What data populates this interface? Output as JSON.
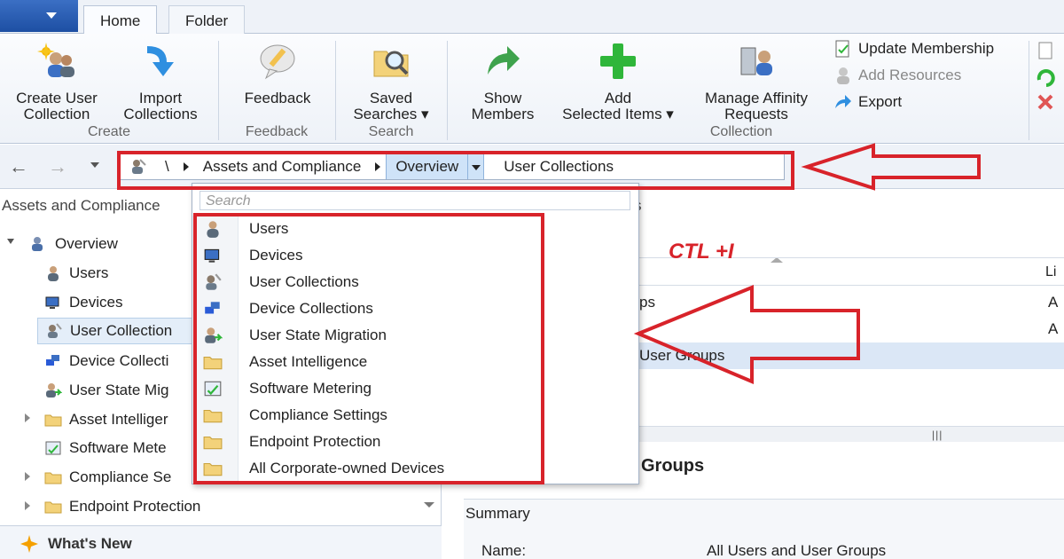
{
  "ribbon": {
    "tabs": [
      {
        "label": "Home"
      },
      {
        "label": "Folder"
      }
    ],
    "buttons": {
      "create_user_collection": "Create User\nCollection",
      "import_collections": "Import\nCollections",
      "feedback": "Feedback",
      "saved_searches": "Saved\nSearches ▾",
      "show_members": "Show\nMembers",
      "add_selected_items": "Add\nSelected Items ▾",
      "manage_affinity": "Manage Affinity\nRequests"
    },
    "small_buttons": {
      "update_membership": "Update Membership",
      "add_resources": "Add Resources",
      "export": "Export"
    },
    "groups": {
      "create": "Create",
      "feedback": "Feedback",
      "search": "Search",
      "collection": "Collection"
    }
  },
  "address_bar": {
    "root": "\\",
    "crumbs": [
      "Assets and Compliance",
      "Overview",
      "User Collections"
    ]
  },
  "left_pane": {
    "heading": "Assets and Compliance",
    "tree": [
      {
        "label": "Overview",
        "icon": "overview-icon"
      },
      {
        "label": "Users",
        "icon": "user-icon"
      },
      {
        "label": "Devices",
        "icon": "devices-icon"
      },
      {
        "label": "User Collection",
        "icon": "user-collection-icon"
      },
      {
        "label": "Device Collecti",
        "icon": "device-collection-icon"
      },
      {
        "label": "User State Mig",
        "icon": "user-state-migration-icon"
      },
      {
        "label": "Asset Intelliger",
        "icon": "folder-icon"
      },
      {
        "label": "Software Mete",
        "icon": "software-metering-icon"
      },
      {
        "label": "Compliance Se",
        "icon": "folder-icon"
      },
      {
        "label": "Endpoint Protection",
        "icon": "folder-icon"
      }
    ],
    "whats_new": "What's New"
  },
  "dropdown": {
    "search_placeholder": "Search",
    "items": [
      {
        "label": "Users",
        "icon": "user-icon"
      },
      {
        "label": "Devices",
        "icon": "devices-icon"
      },
      {
        "label": "User Collections",
        "icon": "user-collection-icon"
      },
      {
        "label": "Device Collections",
        "icon": "device-collection-icon"
      },
      {
        "label": "User State Migration",
        "icon": "user-state-migration-icon"
      },
      {
        "label": "Asset Intelligence",
        "icon": "folder-icon"
      },
      {
        "label": "Software Metering",
        "icon": "software-metering-icon"
      },
      {
        "label": "Compliance Settings",
        "icon": "folder-icon"
      },
      {
        "label": "Endpoint Protection",
        "icon": "folder-icon"
      },
      {
        "label": "All Corporate-owned Devices",
        "icon": "folder-icon"
      }
    ]
  },
  "main": {
    "title_fragment": "s",
    "column_header_fragment": "Li",
    "rows": [
      {
        "c1": "ps",
        "c2": "A"
      },
      {
        "c1": "",
        "c2": "A"
      },
      {
        "c1": "User Groups",
        "c2": ""
      }
    ],
    "detail_title": "Groups",
    "summary_label": "Summary",
    "name_label": "Name:",
    "name_value": "All Users and User Groups"
  },
  "annotation": {
    "shortcut_text": "CTL +I",
    "color": "#d8232a"
  },
  "colors": {
    "ribbon_bg": "#eef2f8",
    "selection": "#cfe3f8",
    "app_button": "#1d4fa3"
  }
}
